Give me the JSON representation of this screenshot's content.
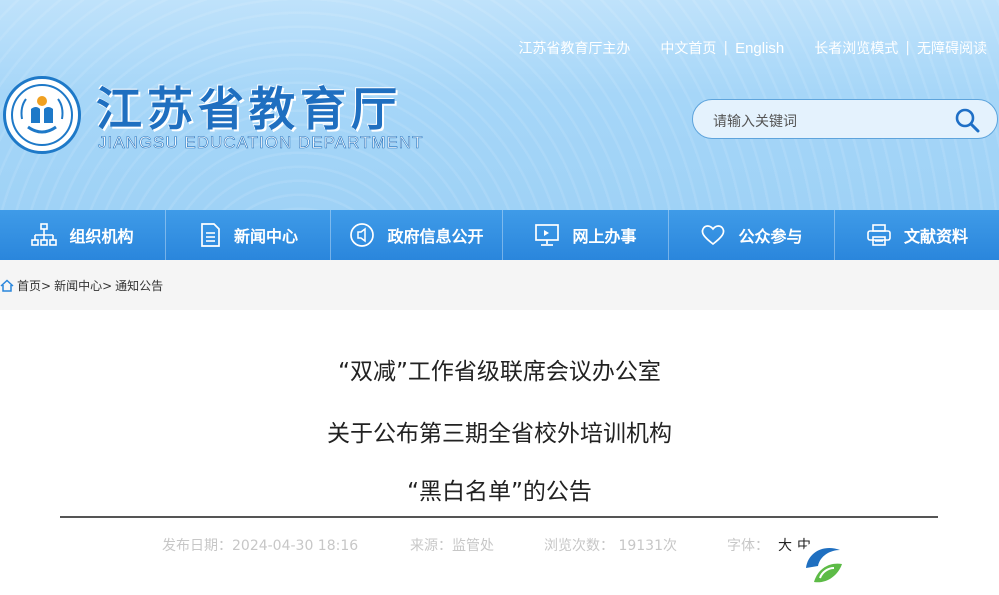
{
  "header": {
    "topbar": {
      "sponsor": "江苏省教育厅主办",
      "home_cn": "中文首页",
      "english": "English",
      "elder_mode": "长者浏览模式",
      "accessible": "无障碍阅读"
    },
    "title_cn": "江苏省教育厅",
    "title_en": "JIANGSU EDUCATION DEPARTMENT",
    "search_placeholder": "请输入关键词"
  },
  "nav": [
    {
      "label": "组织机构",
      "icon": "org-chart-icon"
    },
    {
      "label": "新闻中心",
      "icon": "document-icon"
    },
    {
      "label": "政府信息公开",
      "icon": "speaker-icon"
    },
    {
      "label": "网上办事",
      "icon": "monitor-icon"
    },
    {
      "label": "公众参与",
      "icon": "heart-icon"
    },
    {
      "label": "文献资料",
      "icon": "printer-icon"
    }
  ],
  "breadcrumb": {
    "home": "首页",
    "section": "新闻中心",
    "page": "通知公告",
    "separator": ">"
  },
  "article": {
    "title_line1": "“双减”工作省级联席会议办公室",
    "title_line2": "关于公布第三期全省校外培训机构",
    "title_line3": "“黑白名单”的公告",
    "publish_date": "发布日期：2024-04-30 18:16",
    "source": "来源：监管处",
    "views": "浏览次数：  19131次",
    "font_label": "字体：",
    "font_large": "大",
    "font_medium": "中"
  },
  "colors": {
    "brand_blue": "#1f6fc0",
    "nav_blue": "#2a86dc",
    "header_sky": "#a6d6f8"
  }
}
